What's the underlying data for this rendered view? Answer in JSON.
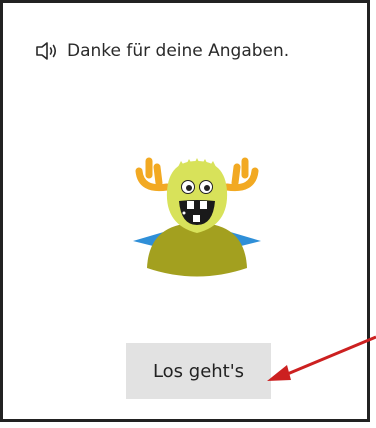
{
  "dialog": {
    "message": "Danke für deine Angaben.",
    "icon": "speaker-icon"
  },
  "mascot": {
    "name": "monster-mascot",
    "colors": {
      "body": "#d8e25a",
      "belly": "#a3a01f",
      "horns": "#f2a922",
      "wings": "#2f8fd8"
    }
  },
  "actions": {
    "start_label": "Los geht's"
  },
  "annotation": {
    "arrow_color": "#cc2020"
  }
}
